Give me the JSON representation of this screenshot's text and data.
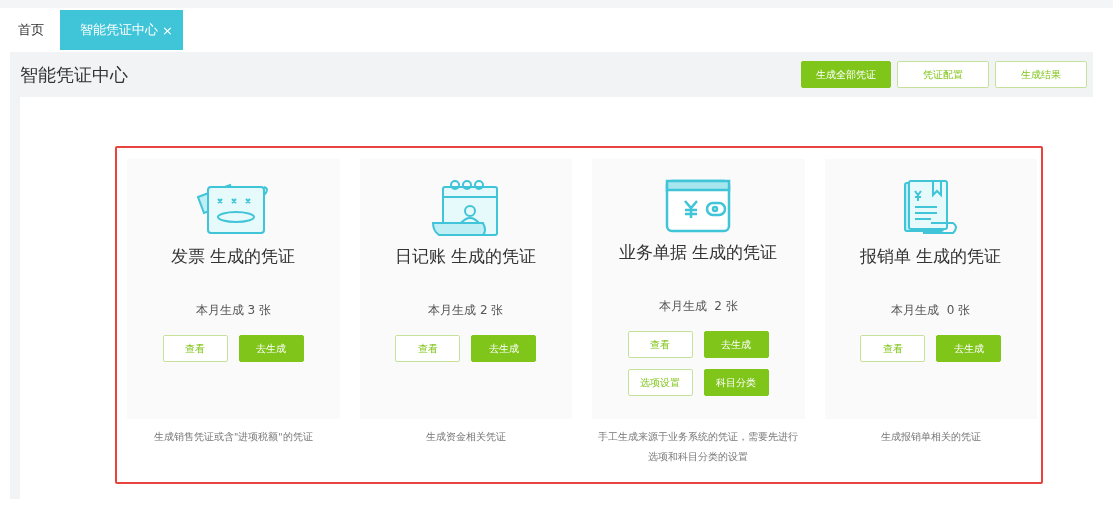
{
  "tabs": [
    {
      "label": "首页",
      "selected": false
    },
    {
      "label": "智能凭证中心",
      "selected": true,
      "close": "×"
    }
  ],
  "header": {
    "title": "智能凭证中心",
    "buttons": [
      {
        "label": "生成全部凭证",
        "kind": "filled"
      },
      {
        "label": "凭证配置",
        "kind": "outline"
      },
      {
        "label": "生成结果",
        "kind": "outline"
      }
    ]
  },
  "cards": [
    {
      "title": "发票 生成的凭证",
      "count": "本月生成 3 张",
      "buttons": [
        {
          "label": "查看",
          "kind": "outline"
        },
        {
          "label": "去生成",
          "kind": "filled"
        }
      ],
      "description": "生成销售凭证或含\"进项税额\"的凭证"
    },
    {
      "title": "日记账 生成的凭证",
      "count": "本月生成 2 张",
      "buttons": [
        {
          "label": "查看",
          "kind": "outline"
        },
        {
          "label": "去生成",
          "kind": "filled"
        }
      ],
      "description": "生成资金相关凭证"
    },
    {
      "title": "业务单据 生成的凭证",
      "count": "本月生成  2 张",
      "buttons": [
        {
          "label": "查看",
          "kind": "outline"
        },
        {
          "label": "去生成",
          "kind": "filled"
        },
        {
          "label": "选项设置",
          "kind": "outline"
        },
        {
          "label": "科目分类",
          "kind": "filled"
        }
      ],
      "description": "手工生成来源于业务系统的凭证，需要先进行选项和科目分类的设置"
    },
    {
      "title": "报销单 生成的凭证",
      "count": "本月生成  0 张",
      "buttons": [
        {
          "label": "查看",
          "kind": "outline"
        },
        {
          "label": "去生成",
          "kind": "filled"
        }
      ],
      "description": "生成报销单相关的凭证"
    }
  ]
}
